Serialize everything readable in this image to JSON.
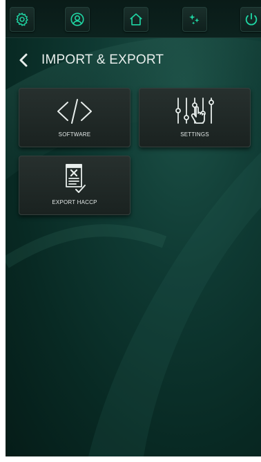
{
  "colors": {
    "accent": "#1fd6a4",
    "icon_white": "#e8eeec",
    "background": "#0f3a33"
  },
  "topbar": {
    "buttons": [
      {
        "name": "settings-button",
        "icon": "gear-icon"
      },
      {
        "name": "user-button",
        "icon": "user-icon"
      },
      {
        "name": "home-button",
        "icon": "home-icon"
      },
      {
        "name": "sparkle-button",
        "icon": "sparkle-icon"
      },
      {
        "name": "power-button",
        "icon": "power-icon"
      }
    ]
  },
  "header": {
    "back_icon": "chevron-left-icon",
    "title": "IMPORT & EXPORT"
  },
  "tiles": [
    {
      "label": "SOFTWARE",
      "icon": "code-icon"
    },
    {
      "label": "SETTINGS",
      "icon": "sliders-touch-icon"
    },
    {
      "label": "EXPORT HACCP",
      "icon": "document-check-icon"
    }
  ]
}
